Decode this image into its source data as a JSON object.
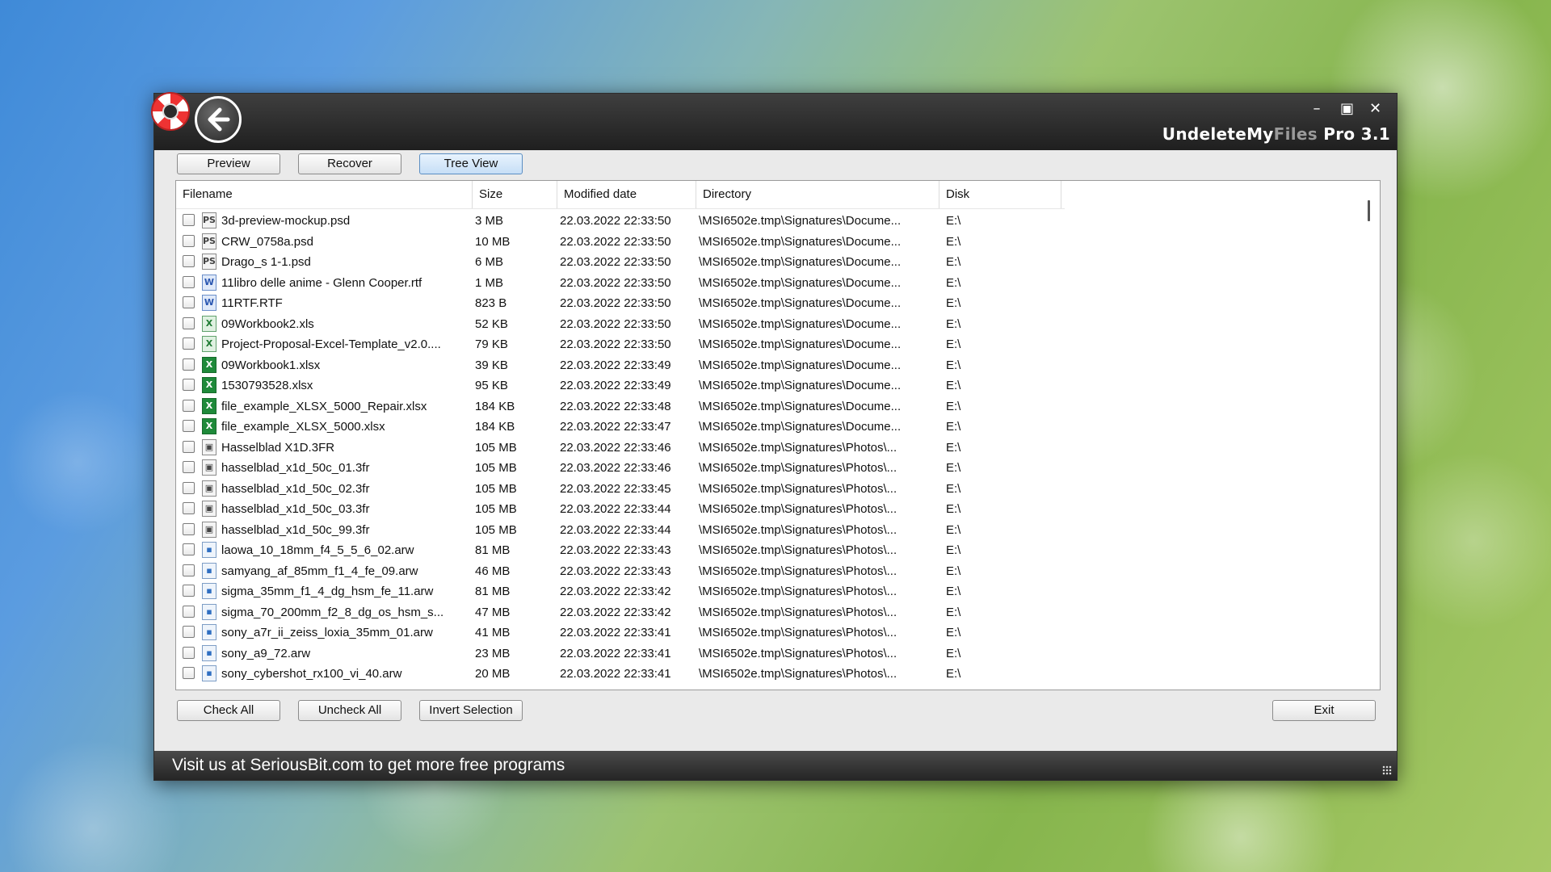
{
  "window": {
    "title_main": "UndeleteMy",
    "title_ghost": "Files",
    "title_tail": " Pro 3.1",
    "controls": {
      "minimize": "–",
      "maximize": "▣",
      "close": "✕"
    }
  },
  "toolbar": {
    "preview": "Preview",
    "recover": "Recover",
    "tree_view": "Tree View"
  },
  "columns": {
    "filename": "Filename",
    "size": "Size",
    "modified": "Modified date",
    "directory": "Directory",
    "disk": "Disk"
  },
  "files": [
    {
      "name": "3d-preview-mockup.psd",
      "size": "3 MB",
      "date": "22.03.2022 22:33:50",
      "dir": "\\MSI6502e.tmp\\Signatures\\Docume...",
      "disk": "E:\\",
      "icon": "img-file-icon",
      "glyph": "PS",
      "type": "t-img"
    },
    {
      "name": "CRW_0758a.psd",
      "size": "10 MB",
      "date": "22.03.2022 22:33:50",
      "dir": "\\MSI6502e.tmp\\Signatures\\Docume...",
      "disk": "E:\\",
      "icon": "img-file-icon",
      "glyph": "PS",
      "type": "t-img"
    },
    {
      "name": "Drago_s 1-1.psd",
      "size": "6 MB",
      "date": "22.03.2022 22:33:50",
      "dir": "\\MSI6502e.tmp\\Signatures\\Docume...",
      "disk": "E:\\",
      "icon": "img-file-icon",
      "glyph": "PS",
      "type": "t-img"
    },
    {
      "name": "11libro delle anime - Glenn Cooper.rtf",
      "size": "1 MB",
      "date": "22.03.2022 22:33:50",
      "dir": "\\MSI6502e.tmp\\Signatures\\Docume...",
      "disk": "E:\\",
      "icon": "word-doc-icon",
      "glyph": "W",
      "type": "t-doc"
    },
    {
      "name": "11RTF.RTF",
      "size": "823 B",
      "date": "22.03.2022 22:33:50",
      "dir": "\\MSI6502e.tmp\\Signatures\\Docume...",
      "disk": "E:\\",
      "icon": "word-doc-icon",
      "glyph": "W",
      "type": "t-doc"
    },
    {
      "name": "09Workbook2.xls",
      "size": "52 KB",
      "date": "22.03.2022 22:33:50",
      "dir": "\\MSI6502e.tmp\\Signatures\\Docume...",
      "disk": "E:\\",
      "icon": "excel-xls-icon",
      "glyph": "X",
      "type": "t-xls"
    },
    {
      "name": "Project-Proposal-Excel-Template_v2.0....",
      "size": "79 KB",
      "date": "22.03.2022 22:33:50",
      "dir": "\\MSI6502e.tmp\\Signatures\\Docume...",
      "disk": "E:\\",
      "icon": "excel-xls-icon",
      "glyph": "X",
      "type": "t-xls"
    },
    {
      "name": "09Workbook1.xlsx",
      "size": "39 KB",
      "date": "22.03.2022 22:33:49",
      "dir": "\\MSI6502e.tmp\\Signatures\\Docume...",
      "disk": "E:\\",
      "icon": "excel-xlsx-icon",
      "glyph": "X",
      "type": "t-xlsx"
    },
    {
      "name": "1530793528.xlsx",
      "size": "95 KB",
      "date": "22.03.2022 22:33:49",
      "dir": "\\MSI6502e.tmp\\Signatures\\Docume...",
      "disk": "E:\\",
      "icon": "excel-xlsx-icon",
      "glyph": "X",
      "type": "t-xlsx"
    },
    {
      "name": "file_example_XLSX_5000_Repair.xlsx",
      "size": "184 KB",
      "date": "22.03.2022 22:33:48",
      "dir": "\\MSI6502e.tmp\\Signatures\\Docume...",
      "disk": "E:\\",
      "icon": "excel-xlsx-icon",
      "glyph": "X",
      "type": "t-xlsx"
    },
    {
      "name": "file_example_XLSX_5000.xlsx",
      "size": "184 KB",
      "date": "22.03.2022 22:33:47",
      "dir": "\\MSI6502e.tmp\\Signatures\\Docume...",
      "disk": "E:\\",
      "icon": "excel-xlsx-icon",
      "glyph": "X",
      "type": "t-xlsx"
    },
    {
      "name": "Hasselblad X1D.3FR",
      "size": "105 MB",
      "date": "22.03.2022 22:33:46",
      "dir": "\\MSI6502e.tmp\\Signatures\\Photos\\...",
      "disk": "E:\\",
      "icon": "img-file-icon",
      "glyph": "▣",
      "type": "t-img"
    },
    {
      "name": "hasselblad_x1d_50c_01.3fr",
      "size": "105 MB",
      "date": "22.03.2022 22:33:46",
      "dir": "\\MSI6502e.tmp\\Signatures\\Photos\\...",
      "disk": "E:\\",
      "icon": "img-file-icon",
      "glyph": "▣",
      "type": "t-img"
    },
    {
      "name": "hasselblad_x1d_50c_02.3fr",
      "size": "105 MB",
      "date": "22.03.2022 22:33:45",
      "dir": "\\MSI6502e.tmp\\Signatures\\Photos\\...",
      "disk": "E:\\",
      "icon": "img-file-icon",
      "glyph": "▣",
      "type": "t-img"
    },
    {
      "name": "hasselblad_x1d_50c_03.3fr",
      "size": "105 MB",
      "date": "22.03.2022 22:33:44",
      "dir": "\\MSI6502e.tmp\\Signatures\\Photos\\...",
      "disk": "E:\\",
      "icon": "img-file-icon",
      "glyph": "▣",
      "type": "t-img"
    },
    {
      "name": "hasselblad_x1d_50c_99.3fr",
      "size": "105 MB",
      "date": "22.03.2022 22:33:44",
      "dir": "\\MSI6502e.tmp\\Signatures\\Photos\\...",
      "disk": "E:\\",
      "icon": "img-file-icon",
      "glyph": "▣",
      "type": "t-img"
    },
    {
      "name": "laowa_10_18mm_f4_5_5_6_02.arw",
      "size": "81 MB",
      "date": "22.03.2022 22:33:43",
      "dir": "\\MSI6502e.tmp\\Signatures\\Photos\\...",
      "disk": "E:\\",
      "icon": "raw-photo-icon",
      "glyph": "▪",
      "type": "t-raw"
    },
    {
      "name": "samyang_af_85mm_f1_4_fe_09.arw",
      "size": "46 MB",
      "date": "22.03.2022 22:33:43",
      "dir": "\\MSI6502e.tmp\\Signatures\\Photos\\...",
      "disk": "E:\\",
      "icon": "raw-photo-icon",
      "glyph": "▪",
      "type": "t-raw"
    },
    {
      "name": "sigma_35mm_f1_4_dg_hsm_fe_11.arw",
      "size": "81 MB",
      "date": "22.03.2022 22:33:42",
      "dir": "\\MSI6502e.tmp\\Signatures\\Photos\\...",
      "disk": "E:\\",
      "icon": "raw-photo-icon",
      "glyph": "▪",
      "type": "t-raw"
    },
    {
      "name": "sigma_70_200mm_f2_8_dg_os_hsm_s...",
      "size": "47 MB",
      "date": "22.03.2022 22:33:42",
      "dir": "\\MSI6502e.tmp\\Signatures\\Photos\\...",
      "disk": "E:\\",
      "icon": "raw-photo-icon",
      "glyph": "▪",
      "type": "t-raw"
    },
    {
      "name": "sony_a7r_ii_zeiss_loxia_35mm_01.arw",
      "size": "41 MB",
      "date": "22.03.2022 22:33:41",
      "dir": "\\MSI6502e.tmp\\Signatures\\Photos\\...",
      "disk": "E:\\",
      "icon": "raw-photo-icon",
      "glyph": "▪",
      "type": "t-raw"
    },
    {
      "name": "sony_a9_72.arw",
      "size": "23 MB",
      "date": "22.03.2022 22:33:41",
      "dir": "\\MSI6502e.tmp\\Signatures\\Photos\\...",
      "disk": "E:\\",
      "icon": "raw-photo-icon",
      "glyph": "▪",
      "type": "t-raw"
    },
    {
      "name": "sony_cybershot_rx100_vi_40.arw",
      "size": "20 MB",
      "date": "22.03.2022 22:33:41",
      "dir": "\\MSI6502e.tmp\\Signatures\\Photos\\...",
      "disk": "E:\\",
      "icon": "raw-photo-icon",
      "glyph": "▪",
      "type": "t-raw"
    }
  ],
  "footer_buttons": {
    "check_all": "Check All",
    "uncheck_all": "Uncheck All",
    "invert": "Invert Selection",
    "exit": "Exit"
  },
  "status": {
    "text": "Visit us at SeriousBit.com to get more free programs"
  }
}
